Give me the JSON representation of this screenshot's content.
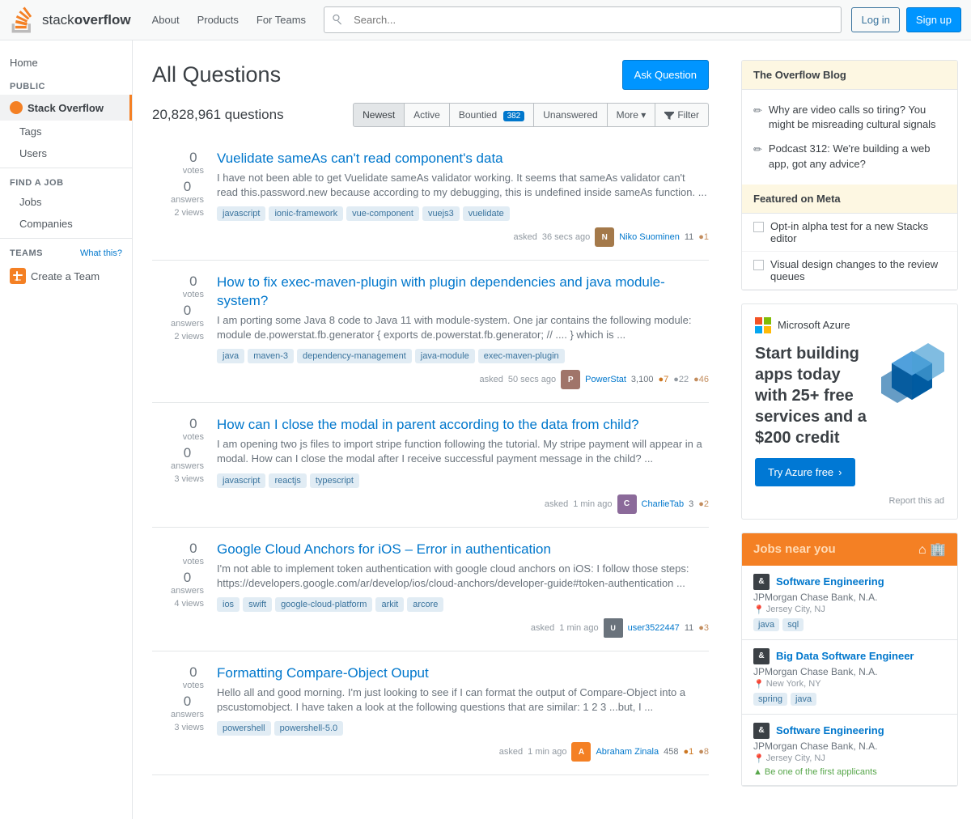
{
  "topbar": {
    "logo_text": "stack overflow",
    "nav": [
      "About",
      "Products",
      "For Teams"
    ],
    "search_placeholder": "Search...",
    "login_label": "Log in",
    "signup_label": "Sign up"
  },
  "sidebar": {
    "home": "Home",
    "public_label": "PUBLIC",
    "stack_overflow": "Stack Overflow",
    "tags": "Tags",
    "users": "Users",
    "find_job_label": "FIND A JOB",
    "jobs": "Jobs",
    "companies": "Companies",
    "teams_label": "TEAMS",
    "teams_what": "What this?",
    "create_team": "Create a Team"
  },
  "content": {
    "title": "All Questions",
    "ask_button": "Ask Question",
    "question_count": "20,828,961 questions",
    "filter_tabs": [
      "Newest",
      "Active",
      "Bountied",
      "Unanswered",
      "More"
    ],
    "bountied_count": "382",
    "more_label": "More ▾",
    "filter_label": "Filter",
    "questions": [
      {
        "id": 1,
        "votes": "0",
        "answers": "0",
        "views": "2 views",
        "title": "Vuelidate sameAs can't read component's data",
        "excerpt": "I have not been able to get Vuelidate sameAs validator working. It seems that sameAs validator can't read this.password.new because according to my debugging, this is undefined inside sameAs function. ...",
        "tags": [
          "javascript",
          "ionic-framework",
          "vue-component",
          "vuejs3",
          "vuelidate"
        ],
        "asked_label": "asked",
        "asked_time": "36 secs ago",
        "user_name": "Niko Suominen",
        "user_rep": "11",
        "user_badges": "●1",
        "avatar_color": "#a4794a",
        "avatar_letter": "N"
      },
      {
        "id": 2,
        "votes": "0",
        "answers": "0",
        "views": "2 views",
        "title": "How to fix exec-maven-plugin with plugin dependencies and java module-system?",
        "excerpt": "I am porting some Java 8 code to Java 11 with module-system. One jar contains the following module: module de.powerstat.fb.generator { exports de.powerstat.fb.generator; // .... } which is ...",
        "tags": [
          "java",
          "maven-3",
          "dependency-management",
          "java-module",
          "exec-maven-plugin"
        ],
        "asked_label": "asked",
        "asked_time": "50 secs ago",
        "user_name": "PowerStat",
        "user_rep": "3,100",
        "user_badges_gold": "●7",
        "user_badges_silver": "●22",
        "user_badges_bronze": "●46",
        "avatar_color": "#a0756a",
        "avatar_letter": "P"
      },
      {
        "id": 3,
        "votes": "0",
        "answers": "0",
        "views": "3 views",
        "title": "How can I close the modal in parent according to the data from child?",
        "excerpt": "I am opening two js files to import stripe function following the tutorial. My stripe payment will appear in a modal. How can I close the modal after I receive successful payment message in the child? ...",
        "tags": [
          "javascript",
          "reactjs",
          "typescript"
        ],
        "asked_label": "asked",
        "asked_time": "1 min ago",
        "user_name": "CharlieTab",
        "user_rep": "3",
        "user_badges": "●2",
        "avatar_color": "#8b6a9a",
        "avatar_letter": "C"
      },
      {
        "id": 4,
        "votes": "0",
        "answers": "0",
        "views": "4 views",
        "title": "Google Cloud Anchors for iOS – Error in authentication",
        "excerpt": "I'm not able to implement token authentication with google cloud anchors on iOS: I follow those steps: https://developers.google.com/ar/develop/ios/cloud-anchors/developer-guide#token-authentication ...",
        "tags": [
          "ios",
          "swift",
          "google-cloud-platform",
          "arkit",
          "arcore"
        ],
        "asked_label": "asked",
        "asked_time": "1 min ago",
        "user_name": "user3522447",
        "user_rep": "11",
        "user_badges": "●3",
        "avatar_color": "#9199a1",
        "avatar_letter": "U"
      },
      {
        "id": 5,
        "votes": "0",
        "answers": "0",
        "views": "3 views",
        "title": "Formatting Compare-Object Ouput",
        "excerpt": "Hello all and good morning. I'm just looking to see if I can format the output of Compare-Object into a pscustomobject. I have taken a look at the following questions that are similar: 1 2 3 ...but, I ...",
        "tags": [
          "powershell",
          "powershell-5.0"
        ],
        "asked_label": "asked",
        "asked_time": "1 min ago",
        "user_name": "Abraham Zinala",
        "user_rep": "458",
        "user_badges_gold": "●1",
        "user_badges_bronze": "●8",
        "avatar_color": "#f48024",
        "avatar_letter": "A"
      }
    ]
  },
  "overflow_blog": {
    "header": "The Overflow Blog",
    "items": [
      "Why are video calls so tiring? You might be misreading cultural signals",
      "Podcast 312: We're building a web app, got any advice?"
    ]
  },
  "featured_meta": {
    "header": "Featured on Meta",
    "items": [
      "Opt-in alpha test for a new Stacks editor",
      "Visual design changes to the review queues"
    ]
  },
  "azure_ad": {
    "brand": "Microsoft Azure",
    "title": "Start building apps today with 25+ free services and a $200 credit",
    "cta": "Try Azure free",
    "report": "Report this ad"
  },
  "jobs": {
    "header_jobs": "Jobs",
    "header_near": " near you",
    "items": [
      {
        "title": "Software Engineering",
        "company": "JPMorgan Chase Bank, N.A.",
        "location": "Jersey City, NJ",
        "tags": [
          "java",
          "sql"
        ]
      },
      {
        "title": "Big Data Software Engineer",
        "company": "JPMorgan Chase Bank, N.A.",
        "location": "New York, NY",
        "tags": [
          "spring",
          "java"
        ]
      },
      {
        "title": "Software Engineering",
        "company": "JPMorgan Chase Bank, N.A.",
        "location": "Jersey City, NJ",
        "tags": [],
        "special": "Be one of the first applicants"
      }
    ]
  }
}
